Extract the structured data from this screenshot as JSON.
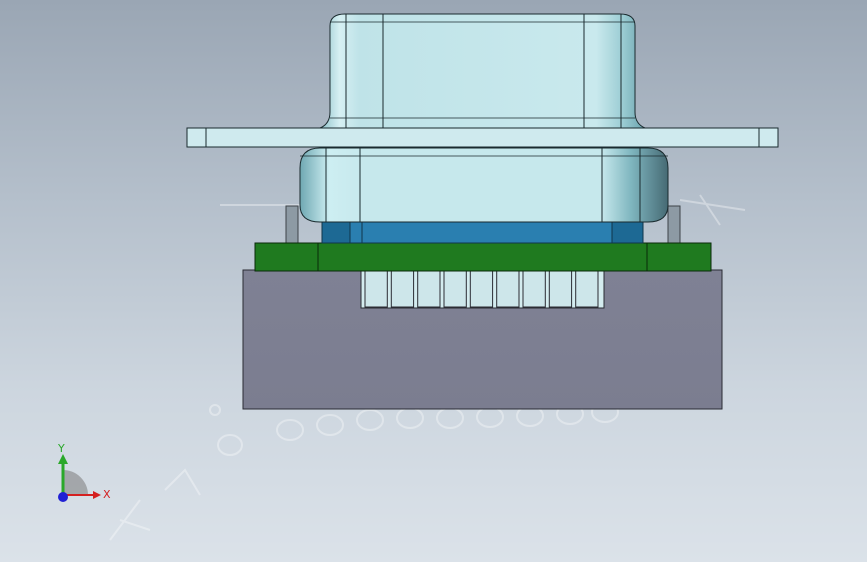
{
  "viewport": {
    "background_top": "#9aa6b4",
    "background_bottom": "#dbe2e9"
  },
  "model": {
    "shell_color": "#c9e8ec",
    "shell_shade": "#7fb3bb",
    "pcb_color": "#1f7a1f",
    "insulator_color": "#2a7fb0",
    "base_color": "#7e8093",
    "pin_count": 9
  },
  "triad": {
    "x_label": "X",
    "y_label": "Y",
    "x_color": "#d42020",
    "y_color": "#2aa82a",
    "z_color": "#2020d4"
  }
}
